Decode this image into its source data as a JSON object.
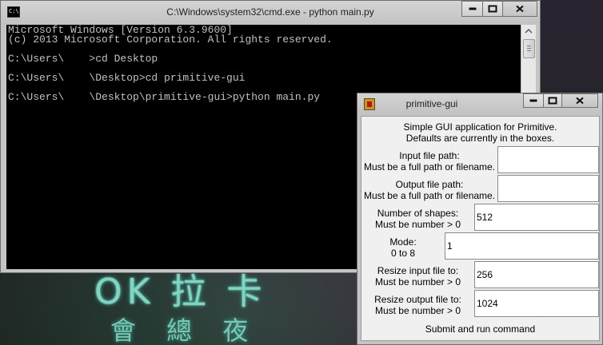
{
  "desktop": {
    "sign_line1": "OK 拉 卡",
    "sign_line2": "會 總 夜"
  },
  "cmd_window": {
    "title": "C:\\Windows\\system32\\cmd.exe - python  main.py",
    "icon": "cmd-icon",
    "icon_text": "C:\\",
    "lines": [
      "Microsoft Windows [Version 6.3.9600]",
      "(c) 2013 Microsoft Corporation. All rights reserved.",
      "",
      "C:\\Users\\    >cd Desktop",
      "",
      "C:\\Users\\    \\Desktop>cd primitive-gui",
      "",
      "C:\\Users\\    \\Desktop\\primitive-gui>python main.py"
    ],
    "text_color": "#c0c0c0",
    "background_color": "#000000"
  },
  "gui_window": {
    "title": "primitive-gui",
    "icon": "feather-icon",
    "header_line1": "Simple GUI application for Primitive.",
    "header_line2": "Defaults are currently in the boxes.",
    "fields": [
      {
        "label1": "Input file path:",
        "label2": "Must be a full path or filename.",
        "value": ""
      },
      {
        "label1": "Output file path:",
        "label2": "Must be a full path or filename.",
        "value": ""
      },
      {
        "label1": "Number of shapes:",
        "label2": "Must be number > 0",
        "value": "512"
      },
      {
        "label1": "Mode:",
        "label2": "0 to 8",
        "value": "1"
      },
      {
        "label1": "Resize input file to:",
        "label2": "Must be number > 0",
        "value": "256"
      },
      {
        "label1": "Resize output file to:",
        "label2": "Must be number > 0",
        "value": "1024"
      }
    ],
    "submit_label": "Submit and run command",
    "close_color": "#c42b1c"
  }
}
